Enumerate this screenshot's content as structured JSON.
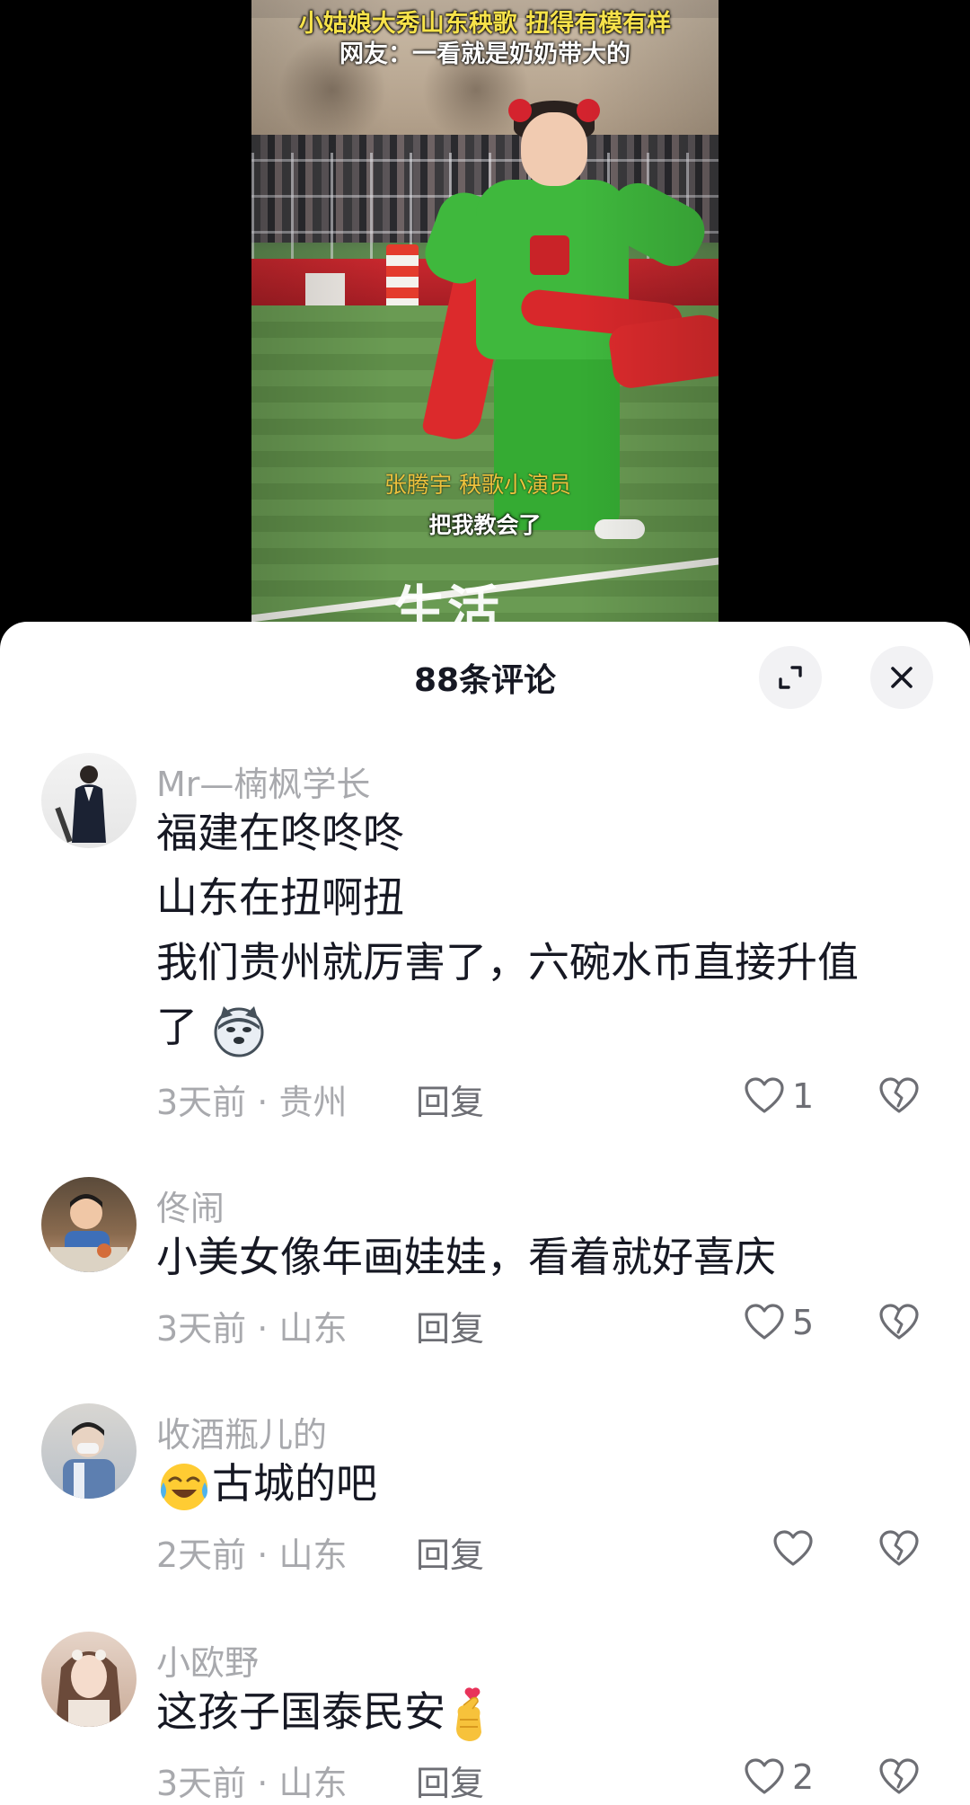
{
  "video": {
    "title_line1": "小姑娘大秀山东秧歌 扭得有模有样",
    "title_line2": "网友：一看就是奶奶带大的",
    "name_caption": "张腾宇 秧歌小演员",
    "subtitle": "把我教会了",
    "watermark": "生活",
    "colors": {
      "title_yellow": "#f6e24a",
      "name_gold": "#ecc23d"
    }
  },
  "sheet": {
    "title": "88条评论",
    "expand_icon": "expand-icon",
    "close_icon": "close-icon"
  },
  "comments": [
    {
      "username": "Mr—楠枫学长",
      "lines": [
        "福建在咚咚咚",
        "山东在扭啊扭",
        "我们贵州就厉害了，六碗水币直接升值",
        "了"
      ],
      "emoji": "doge-emoji",
      "time": "3天前",
      "location": "贵州",
      "reply": "回复",
      "likes": "1"
    },
    {
      "username": "佟闹",
      "lines": [
        "小美女像年画娃娃，看着就好喜庆"
      ],
      "time": "3天前",
      "location": "山东",
      "reply": "回复",
      "likes": "5"
    },
    {
      "username": "收酒瓶儿的",
      "lines": [
        "古城的吧"
      ],
      "emoji": "tears-of-joy-emoji",
      "time": "2天前",
      "location": "山东",
      "reply": "回复",
      "likes": ""
    },
    {
      "username": "小欧野",
      "lines": [
        "这孩子国泰民安"
      ],
      "emoji": "finger-heart-emoji",
      "time": "3天前",
      "location": "山东",
      "reply": "回复",
      "likes": "2"
    }
  ],
  "meta_separator": " · "
}
